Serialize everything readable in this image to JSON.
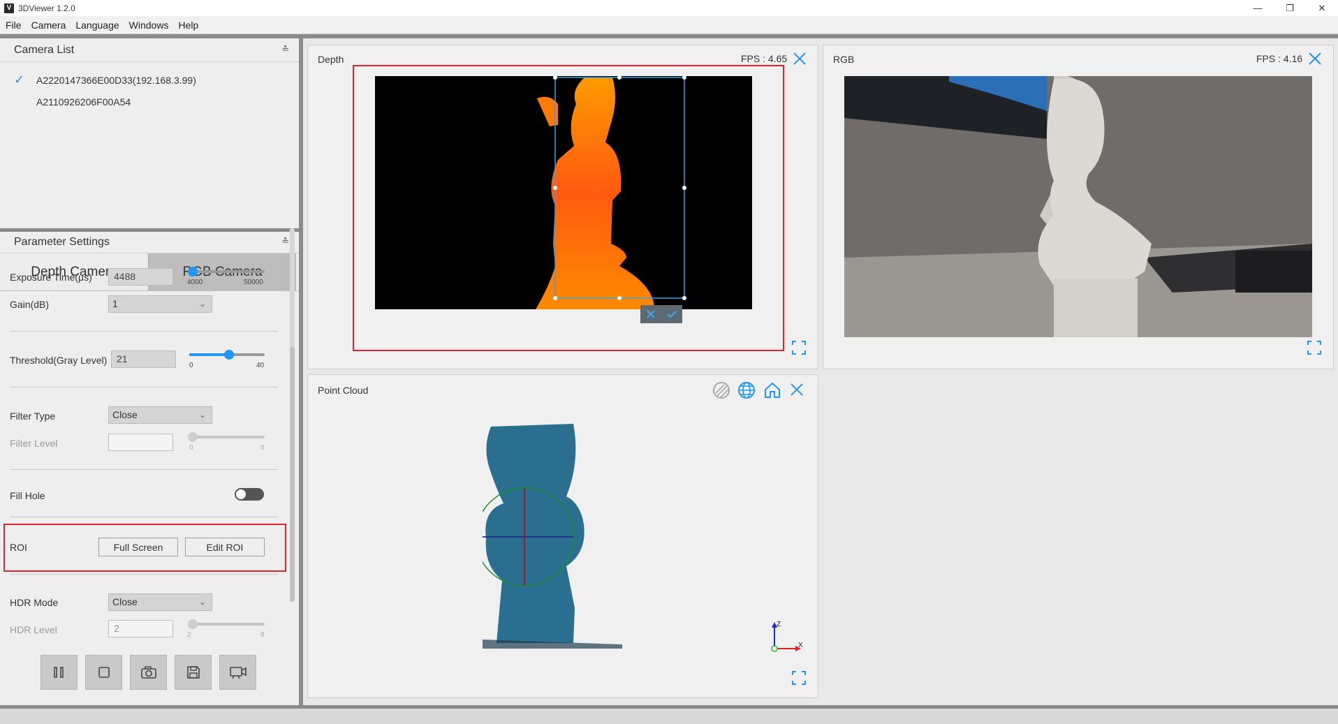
{
  "window": {
    "title": "3DViewer 1.2.0",
    "icon_label": "V"
  },
  "menu": [
    "File",
    "Camera",
    "Language",
    "Windows",
    "Help"
  ],
  "camera_list": {
    "title": "Camera List",
    "items": [
      {
        "label": "A2220147366E00D33(192.168.3.99)",
        "selected": true
      },
      {
        "label": "A2110926206F00A54",
        "selected": false
      }
    ]
  },
  "parameter_settings": {
    "title": "Parameter Settings",
    "tabs": [
      "Depth Camera",
      "RGB Camera"
    ],
    "exposure": {
      "label": "Exposure Time(μs)",
      "value": "4488",
      "min": "4000",
      "max": "50000",
      "level": 0.01
    },
    "gain": {
      "label": "Gain(dB)",
      "value": "1"
    },
    "threshold": {
      "label": "Threshold(Gray Level)",
      "value": "21",
      "min": "0",
      "max": "40",
      "level": 0.525
    },
    "filter_type": {
      "label": "Filter Type",
      "value": "Close"
    },
    "filter_level": {
      "label": "Filter Level",
      "value": "",
      "min": "0",
      "max": "0"
    },
    "fill_hole": {
      "label": "Fill Hole",
      "on": false
    },
    "roi": {
      "label": "ROI",
      "full_screen": "Full Screen",
      "edit_roi": "Edit ROI"
    },
    "hdr_mode": {
      "label": "HDR Mode",
      "value": "Close"
    },
    "hdr_level": {
      "label": "HDR Level",
      "value": "2",
      "min": "2",
      "max": "8"
    }
  },
  "depth_view": {
    "title": "Depth",
    "fps": "FPS : 4.65"
  },
  "rgb_view": {
    "title": "RGB",
    "fps": "FPS : 4.16"
  },
  "pointcloud_view": {
    "title": "Point Cloud"
  },
  "axis_labels": {
    "x": "X",
    "z": "Z"
  },
  "colors": {
    "accent": "#2196f3",
    "highlight": "#e0242b",
    "depth_near": "#ff6a00",
    "cloud": "#2a6f8f"
  }
}
